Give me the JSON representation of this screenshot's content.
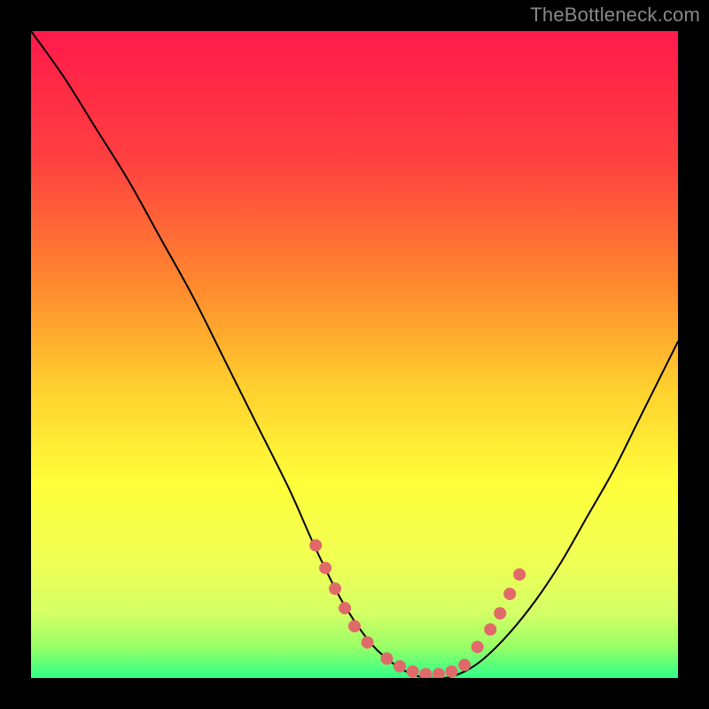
{
  "watermark": "TheBottleneck.com",
  "chart_data": {
    "type": "line",
    "title": "",
    "xlabel": "",
    "ylabel": "",
    "xlim": [
      0,
      100
    ],
    "ylim": [
      0,
      100
    ],
    "gradient_stops": [
      {
        "offset": 0,
        "color": "#ff1a4b"
      },
      {
        "offset": 20,
        "color": "#ff4040"
      },
      {
        "offset": 40,
        "color": "#ff8c2e"
      },
      {
        "offset": 55,
        "color": "#ffcf2e"
      },
      {
        "offset": 70,
        "color": "#ffff3a"
      },
      {
        "offset": 82,
        "color": "#f0ff55"
      },
      {
        "offset": 90,
        "color": "#d4ff66"
      },
      {
        "offset": 95,
        "color": "#9cff66"
      },
      {
        "offset": 100,
        "color": "#2eff87"
      }
    ],
    "series": [
      {
        "name": "curve",
        "x": [
          0,
          5,
          10,
          15,
          20,
          25,
          30,
          35,
          40,
          44,
          48,
          52,
          55,
          58,
          61,
          64,
          67,
          70,
          74,
          78,
          82,
          86,
          90,
          94,
          98,
          100
        ],
        "y": [
          100,
          93,
          85,
          77,
          68,
          59,
          49,
          39,
          29,
          20,
          12,
          6,
          3,
          1,
          0,
          0,
          1,
          3,
          7,
          12,
          18,
          25,
          32,
          40,
          48,
          52
        ]
      }
    ],
    "markers": [
      {
        "x": 44.0,
        "y": 20.5
      },
      {
        "x": 45.5,
        "y": 17.0
      },
      {
        "x": 47.0,
        "y": 13.8
      },
      {
        "x": 48.5,
        "y": 10.8
      },
      {
        "x": 50.0,
        "y": 8.0
      },
      {
        "x": 52.0,
        "y": 5.5
      },
      {
        "x": 55.0,
        "y": 3.0
      },
      {
        "x": 57.0,
        "y": 1.8
      },
      {
        "x": 59.0,
        "y": 1.0
      },
      {
        "x": 61.0,
        "y": 0.6
      },
      {
        "x": 63.0,
        "y": 0.6
      },
      {
        "x": 65.0,
        "y": 1.0
      },
      {
        "x": 67.0,
        "y": 2.0
      },
      {
        "x": 69.0,
        "y": 4.8
      },
      {
        "x": 71.0,
        "y": 7.5
      },
      {
        "x": 72.5,
        "y": 10.0
      },
      {
        "x": 74.0,
        "y": 13.0
      },
      {
        "x": 75.5,
        "y": 16.0
      }
    ],
    "marker_style": {
      "color": "#e06a6a",
      "radius": 7
    }
  }
}
